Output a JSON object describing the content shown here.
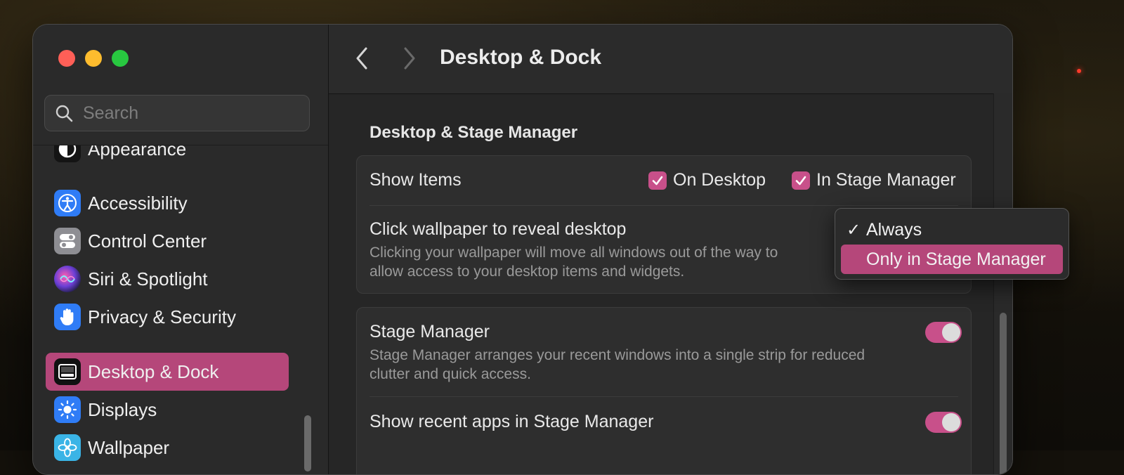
{
  "window": {
    "title": "Desktop & Dock"
  },
  "search": {
    "placeholder": "Search"
  },
  "sidebar": {
    "items": [
      {
        "label": "Appearance",
        "icon": "appearance-icon",
        "color": "#1a1a1a"
      },
      {
        "label": "Accessibility",
        "icon": "accessibility-icon",
        "color": "#2f7cf6"
      },
      {
        "label": "Control Center",
        "icon": "control-center-icon",
        "color": "#8e8e93"
      },
      {
        "label": "Siri & Spotlight",
        "icon": "siri-icon",
        "color": "#6b3fd6"
      },
      {
        "label": "Privacy & Security",
        "icon": "hand-icon",
        "color": "#2f7cf6"
      },
      {
        "label": "Desktop & Dock",
        "icon": "dock-icon",
        "color": "#111111",
        "selected": true
      },
      {
        "label": "Displays",
        "icon": "sun-icon",
        "color": "#2f7cf6"
      },
      {
        "label": "Wallpaper",
        "icon": "flower-icon",
        "color": "#3ab4e6"
      }
    ]
  },
  "content": {
    "section_title": "Desktop & Stage Manager",
    "show_items": {
      "label": "Show Items",
      "on_desktop": {
        "label": "On Desktop",
        "checked": true
      },
      "in_stage_manager": {
        "label": "In Stage Manager",
        "checked": true
      }
    },
    "click_wallpaper": {
      "label": "Click wallpaper to reveal desktop",
      "description_line1": "Clicking your wallpaper will move all windows out of the way to",
      "description_line2": "allow access to your desktop items and widgets."
    },
    "stage_manager": {
      "label": "Stage Manager",
      "description_line1": "Stage Manager arranges your recent windows into a single strip for reduced",
      "description_line2": "clutter and quick access.",
      "enabled": true
    },
    "recent_apps": {
      "label": "Show recent apps in Stage Manager",
      "enabled": true
    }
  },
  "popup": {
    "options": [
      {
        "label": "Always",
        "checkmark": "✓",
        "checked": true,
        "highlighted": false
      },
      {
        "label": "Only in Stage Manager",
        "checkmark": "",
        "checked": false,
        "highlighted": true
      }
    ]
  },
  "colors": {
    "accent": "#b5477a",
    "toggle_on": "#c8508a"
  }
}
